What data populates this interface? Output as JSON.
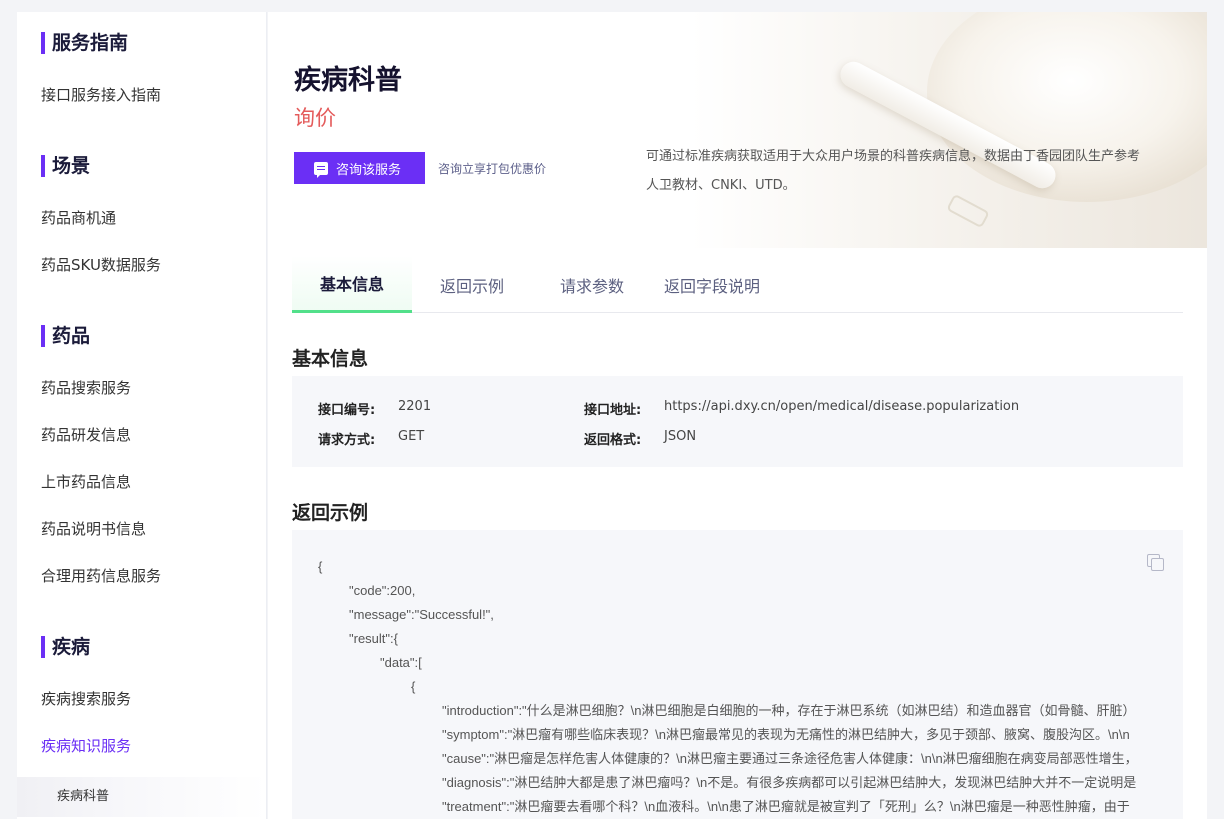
{
  "sidebar": {
    "sections": [
      {
        "title": "服务指南",
        "items": [
          "接口服务接入指南"
        ]
      },
      {
        "title": "场景",
        "items": [
          "药品商机通",
          "药品SKU数据服务"
        ]
      },
      {
        "title": "药品",
        "items": [
          "药品搜索服务",
          "药品研发信息",
          "上市药品信息",
          "药品说明书信息",
          "合理用药信息服务"
        ]
      },
      {
        "title": "疾病",
        "items": [
          "疾病搜索服务",
          "疾病知识服务"
        ]
      }
    ],
    "active_item": "疾病知识服务",
    "sub_item": "疾病科普"
  },
  "hero": {
    "title": "疾病科普",
    "price": "询价",
    "consult_button": "咨询该服务",
    "consult_tip": "咨询立享打包优惠价",
    "description": "可通过标准疾病获取适用于大众用户场景的科普疾病信息，数据由丁香园团队生产参考人卫教材、CNKI、UTD。"
  },
  "tabs": [
    "基本信息",
    "返回示例",
    "请求参数",
    "返回字段说明"
  ],
  "active_tab": "基本信息",
  "basic_info": {
    "title": "基本信息",
    "interface_id_label": "接口编号:",
    "interface_id": "2201",
    "interface_url_label": "接口地址:",
    "interface_url": "https://api.dxy.cn/open/medical/disease.popularization",
    "method_label": "请求方式:",
    "method": "GET",
    "format_label": "返回格式:",
    "format": "JSON"
  },
  "example": {
    "title": "返回示例",
    "lines": [
      "{",
      "\"code\":200,",
      "\"message\":\"Successful!\",",
      "\"result\":{",
      "\"data\":[",
      "{",
      "\"introduction\":\"什么是淋巴细胞？\\n淋巴细胞是白细胞的一种，存在于淋巴系统（如淋巴结）和造血器官（如骨髓、肝脏）",
      "\"symptom\":\"淋巴瘤有哪些临床表现？\\n淋巴瘤最常见的表现为无痛性的淋巴结肿大，多见于颈部、腋窝、腹股沟区。\\n\\n",
      "\"cause\":\"淋巴瘤是怎样危害人体健康的？\\n淋巴瘤主要通过三条途径危害人体健康：\\n\\n淋巴瘤细胞在病变局部恶性增生，",
      "\"diagnosis\":\"淋巴结肿大都是患了淋巴瘤吗？\\n不是。有很多疾病都可以引起淋巴结肿大，发现淋巴结肿大并不一定说明是",
      "\"treatment\":\"淋巴瘤要去看哪个科？\\n血液科。\\n\\n患了淋巴瘤就是被宣判了「死刑」么？\\n淋巴瘤是一种恶性肿瘤，由于"
    ]
  }
}
